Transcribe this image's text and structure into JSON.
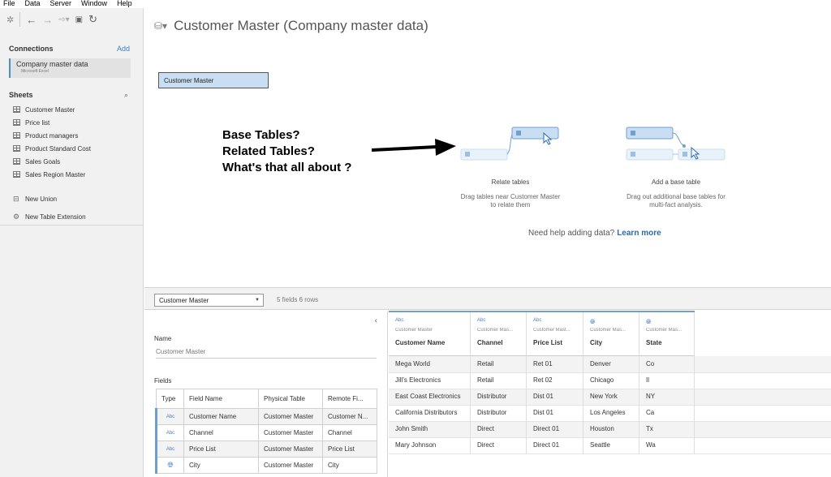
{
  "menu": [
    "File",
    "Data",
    "Server",
    "Window",
    "Help"
  ],
  "sidebar": {
    "connections_title": "Connections",
    "add_label": "Add",
    "connection": {
      "name": "Company master data",
      "type": "Microsoft Excel"
    },
    "sheets_title": "Sheets",
    "sheets": [
      "Customer Master",
      "Price list",
      "Product managers",
      "Product Standard Cost",
      "Sales Goals",
      "Sales Region Master"
    ],
    "new_union": "New Union",
    "new_table_extension": "New Table Extension"
  },
  "canvas": {
    "title": "Customer Master  (Company master data)",
    "table_chip": "Customer Master",
    "annotation": [
      "Base Tables?",
      "Related Tables?",
      "What's that all about ?"
    ],
    "relate": {
      "title": "Relate tables",
      "desc1": "Drag tables near Customer Master",
      "desc2": "to relate them"
    },
    "base": {
      "title": "Add a base table",
      "desc1": "Drag out additional base tables for",
      "desc2": "multi-fact analysis."
    },
    "help_text": "Need help adding data?",
    "help_link": "Learn more",
    "accent_color": "#c9def2"
  },
  "split": {
    "selected_table": "Customer Master",
    "field_count": "5 fields 6 rows"
  },
  "meta": {
    "name_label": "Name",
    "name_value": "Customer Master",
    "fields_label": "Fields",
    "headers": [
      "Type",
      "Field Name",
      "Physical Table",
      "Remote Fi..."
    ],
    "rows": [
      {
        "type": "Abc",
        "field": "Customer Name",
        "table": "Customer Master",
        "remote": "Customer N..."
      },
      {
        "type": "Abc",
        "field": "Channel",
        "table": "Customer Master",
        "remote": "Channel"
      },
      {
        "type": "Abc",
        "field": "Price List",
        "table": "Customer Master",
        "remote": "Price List"
      },
      {
        "type": "globe-icon",
        "field": "City",
        "table": "Customer Master",
        "remote": "City"
      }
    ]
  },
  "grid": {
    "columns": [
      {
        "type": "Abc",
        "table": "Customer Master",
        "name": "Customer Name"
      },
      {
        "type": "Abc",
        "table": "Customer Mas...",
        "name": "Channel"
      },
      {
        "type": "Abc",
        "table": "Customer Mast...",
        "name": "Price List"
      },
      {
        "type": "globe-icon",
        "table": "Customer Mas...",
        "name": "City"
      },
      {
        "type": "globe-icon",
        "table": "Customer Mas...",
        "name": "State"
      }
    ],
    "rows": [
      [
        "Mega World",
        "Retail",
        "Ret 01",
        "Denver",
        "Co"
      ],
      [
        "Jill's Electronics",
        "Retail",
        "Ret 02",
        "Chicago",
        "Il"
      ],
      [
        "East Coast Electronics",
        "Distributor",
        "Dist 01",
        "New York",
        "NY"
      ],
      [
        "California Distributors",
        "Distributor",
        "Dist 01",
        "Los Angeles",
        "Ca"
      ],
      [
        "John Smith",
        "Direct",
        "Direct 01",
        "Houston",
        "Tx"
      ],
      [
        "Mary Johnson",
        "Direct",
        "Direct 01",
        "Seattle",
        "Wa"
      ]
    ]
  }
}
